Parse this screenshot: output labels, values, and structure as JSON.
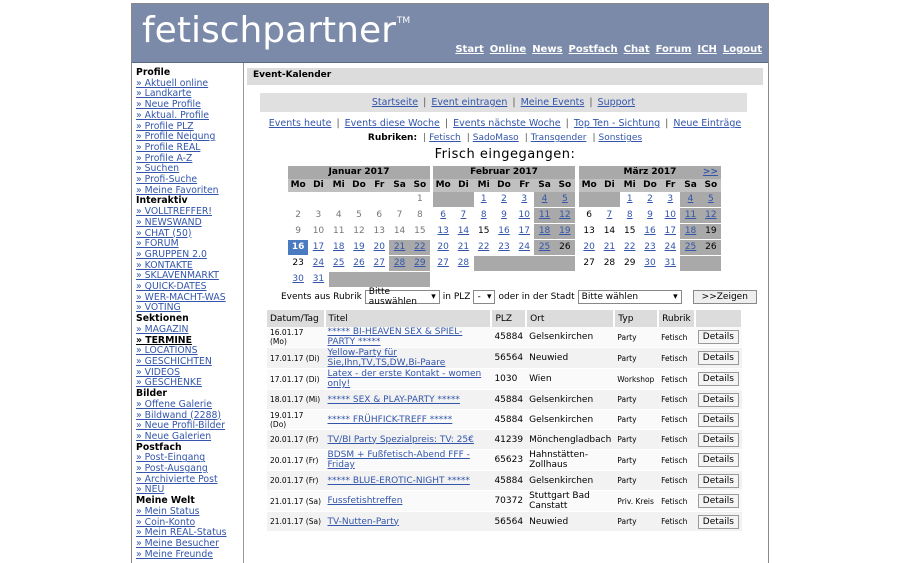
{
  "header": {
    "logo": "fetischpartner",
    "tm": "TM",
    "nav": [
      {
        "label": "Start"
      },
      {
        "label": "Online"
      },
      {
        "label": "News"
      },
      {
        "label": "Postfach"
      },
      {
        "label": "Chat",
        "count": "(50)"
      },
      {
        "label": "Forum"
      },
      {
        "label": "ICH"
      },
      {
        "label": "Logout"
      }
    ]
  },
  "sidebar": [
    {
      "heading": "Profile",
      "items": [
        "» Aktuell online",
        "» Landkarte",
        "» Neue Profile",
        "» Aktual. Profile",
        "» Profile PLZ",
        "» Profile Neigung",
        "» Profile REAL",
        "» Profile A-Z",
        "» Suchen",
        "» Profi-Suche",
        "» Meine Favoriten"
      ]
    },
    {
      "heading": "Interaktiv",
      "items": [
        "» VOLLTREFFER!",
        "» NEWSWAND",
        "» CHAT (50)",
        "» FORUM",
        "» GRUPPEN 2.0",
        "» KONTAKTE",
        "» SKLAVENMARKT",
        "» QUICK-DATES",
        "» WER-MACHT-WAS",
        "» VOTING"
      ]
    },
    {
      "heading": "Sektionen",
      "items": [
        "» MAGAZIN",
        "» TERMINE",
        "» LOCATIONS",
        "» GESCHICHTEN",
        "» VIDEOS",
        "» GESCHENKE"
      ]
    },
    {
      "heading": "Bilder",
      "items": [
        "» Offene Galerie",
        "» Bildwand (2288)",
        "» Neue Profil-Bilder",
        "» Neue Galerien"
      ]
    },
    {
      "heading": "Postfach",
      "items": [
        "» Post-Eingang",
        "» Post-Ausgang",
        "» Archivierte Post",
        "» NEU"
      ]
    },
    {
      "heading": "Meine Welt",
      "items": [
        "» Mein Status",
        "» Coin-Konto",
        "» Mein REAL-Status",
        "» Meine Besucher",
        "» Meine Freunde"
      ]
    }
  ],
  "main": {
    "title": "Event-Kalender",
    "subnav": [
      "Startseite",
      "Event eintragen",
      "Meine Events",
      "Support"
    ],
    "links": [
      "Events heute",
      "Events diese Woche",
      "Events nächste Woche",
      "Top Ten - Sichtung",
      "Neue Einträge"
    ],
    "rubriken_label": "Rubriken:",
    "rubriken": [
      "Fetisch",
      "SadoMaso",
      "Transgender",
      "Sonstiges"
    ],
    "fresh": "Frisch eingegangen:",
    "calendars": [
      {
        "month": "Januar 2017",
        "next": "",
        "weeks": [
          [
            [
              "",
              "e"
            ],
            [
              "",
              "e"
            ],
            [
              "",
              "e"
            ],
            [
              "",
              "e"
            ],
            [
              "",
              "e"
            ],
            [
              "",
              "e"
            ],
            [
              "1",
              "g"
            ]
          ],
          [
            [
              "2",
              "g"
            ],
            [
              "3",
              "g"
            ],
            [
              "4",
              "g"
            ],
            [
              "5",
              "g"
            ],
            [
              "6",
              "g"
            ],
            [
              "7",
              "g"
            ],
            [
              "8",
              "g"
            ]
          ],
          [
            [
              "9",
              "g"
            ],
            [
              "10",
              "g"
            ],
            [
              "11",
              "g"
            ],
            [
              "12",
              "g"
            ],
            [
              "13",
              "g"
            ],
            [
              "14",
              "g"
            ],
            [
              "15",
              "g"
            ]
          ],
          [
            [
              "16",
              "t"
            ],
            [
              "17",
              "l"
            ],
            [
              "18",
              "l"
            ],
            [
              "19",
              "l"
            ],
            [
              "20",
              "l"
            ],
            [
              "21",
              "lw"
            ],
            [
              "22",
              "lw"
            ]
          ],
          [
            [
              "23",
              ""
            ],
            [
              "24",
              "l"
            ],
            [
              "25",
              "l"
            ],
            [
              "26",
              "l"
            ],
            [
              "27",
              "l"
            ],
            [
              "28",
              "lw"
            ],
            [
              "29",
              "lw"
            ]
          ],
          [
            [
              "30",
              "l"
            ],
            [
              "31",
              "l"
            ],
            [
              "",
              "w"
            ],
            [
              "",
              "w"
            ],
            [
              "",
              "w"
            ],
            [
              "",
              "w"
            ],
            [
              "",
              "w"
            ]
          ]
        ]
      },
      {
        "month": "Februar 2017",
        "next": "",
        "weeks": [
          [
            [
              "",
              "w"
            ],
            [
              "",
              "w"
            ],
            [
              "1",
              "l"
            ],
            [
              "2",
              "l"
            ],
            [
              "3",
              "l"
            ],
            [
              "4",
              "lw"
            ],
            [
              "5",
              "lw"
            ]
          ],
          [
            [
              "6",
              "l"
            ],
            [
              "7",
              "l"
            ],
            [
              "8",
              "l"
            ],
            [
              "9",
              "l"
            ],
            [
              "10",
              "l"
            ],
            [
              "11",
              "lw"
            ],
            [
              "12",
              "lw"
            ]
          ],
          [
            [
              "13",
              "l"
            ],
            [
              "14",
              "l"
            ],
            [
              "15",
              ""
            ],
            [
              "16",
              "l"
            ],
            [
              "17",
              "l"
            ],
            [
              "18",
              "lw"
            ],
            [
              "19",
              "lw"
            ]
          ],
          [
            [
              "20",
              "l"
            ],
            [
              "21",
              "l"
            ],
            [
              "22",
              "l"
            ],
            [
              "23",
              "l"
            ],
            [
              "24",
              "l"
            ],
            [
              "25",
              "lw"
            ],
            [
              "26",
              "w"
            ]
          ],
          [
            [
              "27",
              "l"
            ],
            [
              "28",
              "l"
            ],
            [
              "",
              "w"
            ],
            [
              "",
              "w"
            ],
            [
              "",
              "w"
            ],
            [
              "",
              "w"
            ],
            [
              "",
              "w"
            ]
          ]
        ]
      },
      {
        "month": "März 2017",
        "next": ">>",
        "weeks": [
          [
            [
              "",
              "w"
            ],
            [
              "",
              "w"
            ],
            [
              "1",
              "l"
            ],
            [
              "2",
              "l"
            ],
            [
              "3",
              "l"
            ],
            [
              "4",
              "lw"
            ],
            [
              "5",
              "lw"
            ]
          ],
          [
            [
              "6",
              ""
            ],
            [
              "7",
              "l"
            ],
            [
              "8",
              "l"
            ],
            [
              "9",
              "l"
            ],
            [
              "10",
              "l"
            ],
            [
              "11",
              "lw"
            ],
            [
              "12",
              "lw"
            ]
          ],
          [
            [
              "13",
              ""
            ],
            [
              "14",
              ""
            ],
            [
              "15",
              ""
            ],
            [
              "16",
              "l"
            ],
            [
              "17",
              "l"
            ],
            [
              "18",
              "lw"
            ],
            [
              "19",
              "w"
            ]
          ],
          [
            [
              "20",
              "l"
            ],
            [
              "21",
              "l"
            ],
            [
              "22",
              "l"
            ],
            [
              "23",
              "l"
            ],
            [
              "24",
              "l"
            ],
            [
              "25",
              "lw"
            ],
            [
              "26",
              "w"
            ]
          ],
          [
            [
              "27",
              ""
            ],
            [
              "28",
              ""
            ],
            [
              "29",
              ""
            ],
            [
              "30",
              "l"
            ],
            [
              "31",
              "l"
            ],
            [
              "",
              "w"
            ],
            [
              "",
              "w"
            ]
          ]
        ]
      }
    ],
    "dayheads": [
      "Mo",
      "Di",
      "Mi",
      "Do",
      "Fr",
      "Sa",
      "So"
    ],
    "filter": {
      "prefix": "Events aus Rubrik",
      "rubrik": "Bitte auswählen",
      "in_plz": "in PLZ",
      "plz": "-",
      "oder": "oder in der Stadt",
      "stadt": "Bitte wählen",
      "button": ">>Zeigen"
    },
    "table": {
      "headers": [
        "Datum/Tag",
        "Titel",
        "PLZ",
        "Ort",
        "Typ",
        "Rubrik",
        ""
      ],
      "details_label": "Details",
      "rows": [
        {
          "date": "16.01.17 (Mo)",
          "title": "***** BI-HEAVEN SEX & SPIEL-PARTY *****",
          "plz": "45884",
          "ort": "Gelsenkirchen",
          "typ": "Party",
          "rubrik": "Fetisch"
        },
        {
          "date": "17.01.17 (Di)",
          "title": "Yellow-Party für Sie,Ihn,TV,TS,DW,Bi-Paare",
          "plz": "56564",
          "ort": "Neuwied",
          "typ": "Party",
          "rubrik": "Fetisch"
        },
        {
          "date": "17.01.17 (Di)",
          "title": "Latex - der erste Kontakt - women only!",
          "plz": "1030",
          "ort": "Wien",
          "typ": "Workshop",
          "rubrik": "Fetisch"
        },
        {
          "date": "18.01.17 (Mi)",
          "title": "***** SEX & PLAY-PARTY *****",
          "plz": "45884",
          "ort": "Gelsenkirchen",
          "typ": "Party",
          "rubrik": "Fetisch"
        },
        {
          "date": "19.01.17 (Do)",
          "title": "***** FRÜHFICK-TREFF *****",
          "plz": "45884",
          "ort": "Gelsenkirchen",
          "typ": "Party",
          "rubrik": "Fetisch"
        },
        {
          "date": "20.01.17 (Fr)",
          "title": "TV/BI Party Spezialpreis: TV: 25€",
          "plz": "41239",
          "ort": "Mönchengladbach",
          "typ": "Party",
          "rubrik": "Fetisch"
        },
        {
          "date": "20.01.17 (Fr)",
          "title": "BDSM + Fußfetisch-Abend FFF - Friday",
          "plz": "65623",
          "ort": "Hahnstätten-Zollhaus",
          "typ": "Party",
          "rubrik": "Fetisch"
        },
        {
          "date": "20.01.17 (Fr)",
          "title": "***** BLUE-EROTIC-NIGHT *****",
          "plz": "45884",
          "ort": "Gelsenkirchen",
          "typ": "Party",
          "rubrik": "Fetisch"
        },
        {
          "date": "21.01.17 (Sa)",
          "title": "Fussfetishtreffen",
          "plz": "70372",
          "ort": "Stuttgart Bad Canstatt",
          "typ": "Priv. Kreis",
          "rubrik": "Fetisch"
        },
        {
          "date": "21.01.17 (Sa)",
          "title": "TV-Nutten-Party",
          "plz": "56564",
          "ort": "Neuwied",
          "typ": "Party",
          "rubrik": "Fetisch"
        }
      ]
    }
  }
}
